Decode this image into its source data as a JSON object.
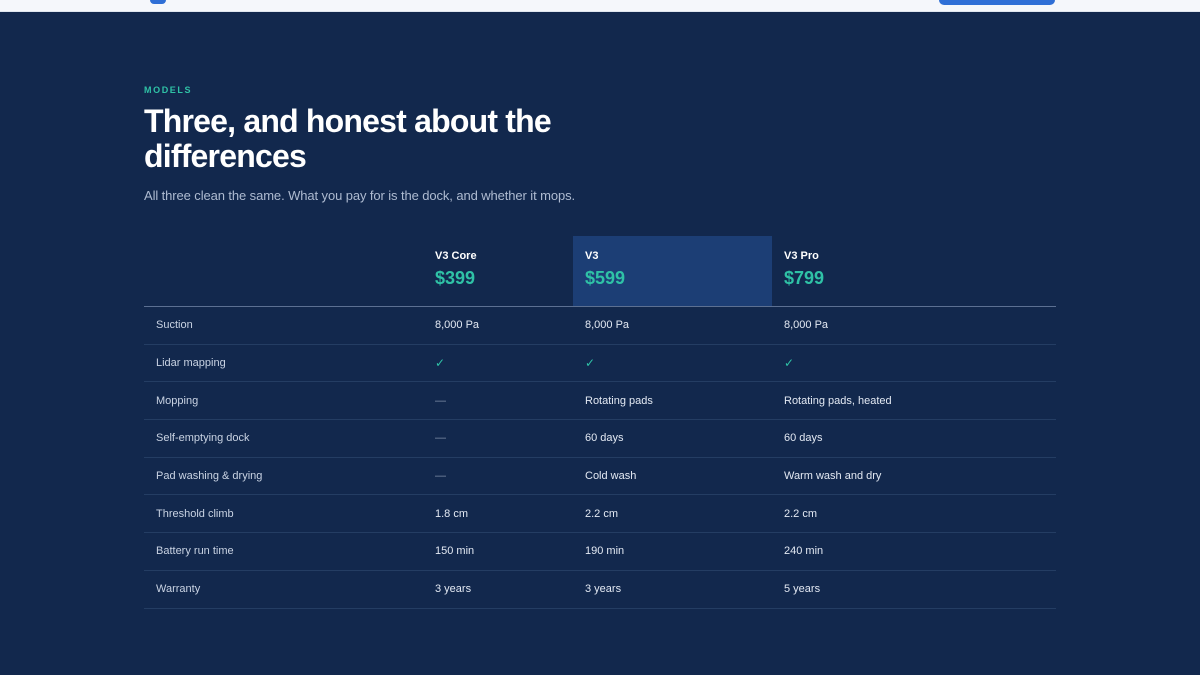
{
  "section": {
    "eyebrow": "MODELS",
    "title": "Three, and honest about the differences",
    "subtitle": "All three clean the same. What you pay for is the dock, and whether it mops."
  },
  "plans": [
    {
      "name": "V3 Core",
      "price": "$399",
      "featured": false
    },
    {
      "name": "V3",
      "price": "$599",
      "featured": true
    },
    {
      "name": "V3 Pro",
      "price": "$799",
      "featured": false
    }
  ],
  "rows": [
    {
      "label": "Suction",
      "values": [
        "8,000 Pa",
        "8,000 Pa",
        "8,000 Pa"
      ]
    },
    {
      "label": "Lidar mapping",
      "values": [
        "✓",
        "✓",
        "✓"
      ]
    },
    {
      "label": "Mopping",
      "values": [
        "—",
        "Rotating pads",
        "Rotating pads, heated"
      ]
    },
    {
      "label": "Self-emptying dock",
      "values": [
        "—",
        "60 days",
        "60 days"
      ]
    },
    {
      "label": "Pad washing & drying",
      "values": [
        "—",
        "Cold wash",
        "Warm wash and dry"
      ]
    },
    {
      "label": "Threshold climb",
      "values": [
        "1.8 cm",
        "2.2 cm",
        "2.2 cm"
      ]
    },
    {
      "label": "Battery run time",
      "values": [
        "150 min",
        "190 min",
        "240 min"
      ]
    },
    {
      "label": "Warranty",
      "values": [
        "3 years",
        "3 years",
        "5 years"
      ]
    }
  ],
  "colors": {
    "background": "#12284d",
    "accent": "#2fc2a6",
    "featured_column": "#1c3e75",
    "brand_blue": "#2f6fd6"
  }
}
